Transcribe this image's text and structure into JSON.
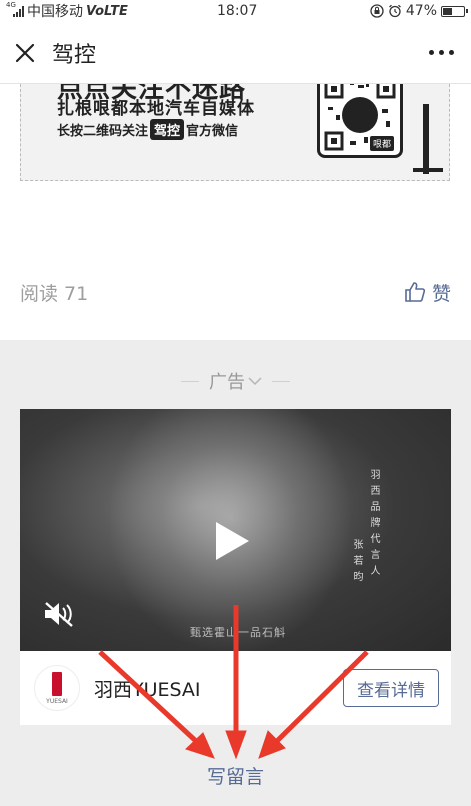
{
  "status_bar": {
    "network_type": "4G",
    "carrier": "中国移动",
    "volte": "VoLTE",
    "time": "18:07",
    "battery_percent": "47%",
    "battery_level": 0.47,
    "icons": [
      "signal-icon",
      "lock-icon",
      "alarm-icon",
      "battery-icon"
    ]
  },
  "title_bar": {
    "title": "驾控",
    "close_icon": "close-icon",
    "more_icon": "more-dots-icon"
  },
  "article": {
    "banner": {
      "headline": "点点关注不迷路",
      "line1": "扎根哏都本地汽车自媒体",
      "line2_prefix": "长按二维码关注",
      "line2_brand": "驾控",
      "line2_suffix": "官方微信",
      "qr_tag": "哏都"
    },
    "read_label": "阅读 71",
    "like_label": "赞"
  },
  "ad": {
    "label": "广告",
    "video_vertical_text_1": "羽西品牌代言人",
    "video_vertical_text_2": "张若昀",
    "video_caption": "甄选霍山一品石斛",
    "brand_logo_text": "YUESAI",
    "brand_name": "羽西YUESAI",
    "details_button": "查看详情"
  },
  "comment_link": "写留言",
  "colors": {
    "link_blue": "#576b95",
    "annotation_red": "#e8392b",
    "brand_red": "#c8102e"
  }
}
